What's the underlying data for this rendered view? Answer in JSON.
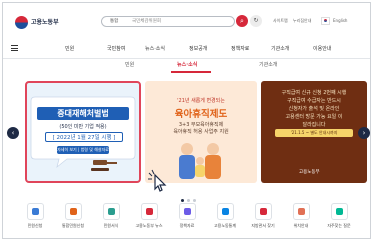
{
  "header": {
    "logo_text": "고용노동부",
    "search_prefix": "통합",
    "search_placeholder": "국민체감위원회",
    "search_icon": "search-icon",
    "recent_icon": "refresh-icon",
    "util_links": [
      "사이트맵",
      "누리집안내",
      "English"
    ],
    "brand_color": "#d6283a"
  },
  "gnb": {
    "menu_icon": "hamburger-icon",
    "items": [
      "민원",
      "국민참여",
      "뉴스·소식",
      "정보공개",
      "정책자료",
      "기관소개",
      "이용안내"
    ]
  },
  "subtabs": {
    "items": [
      "민원",
      "뉴스·소식",
      "기관소개"
    ],
    "active_index": 1
  },
  "carousel": {
    "prev_icon": "chevron-left-icon",
    "next_icon": "chevron-right-icon",
    "slide1": {
      "title": "중대재해처벌법",
      "subtitle": "(50인 미만 기업 적용)",
      "date": "[ 2022년 1월 27일 시행 ]",
      "button": "자세히 보기 | 법령 및 해설자료"
    },
    "slide2": {
      "top": "'21년 새롭게 변경되는",
      "title": "육아휴직제도",
      "line1": "3+3 부모육아휴직제",
      "line2": "육아휴직 허용 사업주 지원"
    },
    "slide3": {
      "lines": [
        "구직급여 신규 신청 2번째 시행",
        "구직급여 수급자는 반드시",
        "신청자가 출석 및 온라인",
        "고용센터 방문 가능 요일 이",
        "달라집니다"
      ],
      "date": "'21.1.5 ~ 별도 안내시까지",
      "logo": "고용노동부"
    },
    "slide_count": 3,
    "active_slide": 0
  },
  "quick_menu": [
    {
      "label": "민원신청",
      "icon": "document-icon",
      "color": "#3a7bd5"
    },
    {
      "label": "통합민원신청",
      "icon": "form-icon",
      "color": "#e0631a"
    },
    {
      "label": "민원서식",
      "icon": "file-icon",
      "color": "#2a9d8f"
    },
    {
      "label": "고용노동부 뉴스",
      "icon": "news-icon",
      "color": "#d6283a"
    },
    {
      "label": "정책자료",
      "icon": "chart-icon",
      "color": "#6c5ce7"
    },
    {
      "label": "고용노동통계",
      "icon": "stats-icon",
      "color": "#0984e3"
    },
    {
      "label": "지방관서 찾기",
      "icon": "map-icon",
      "color": "#d6283a"
    },
    {
      "label": "위치안내",
      "icon": "location-icon",
      "color": "#e17055"
    },
    {
      "label": "자주찾는 질문",
      "icon": "question-icon",
      "color": "#00b894"
    }
  ]
}
